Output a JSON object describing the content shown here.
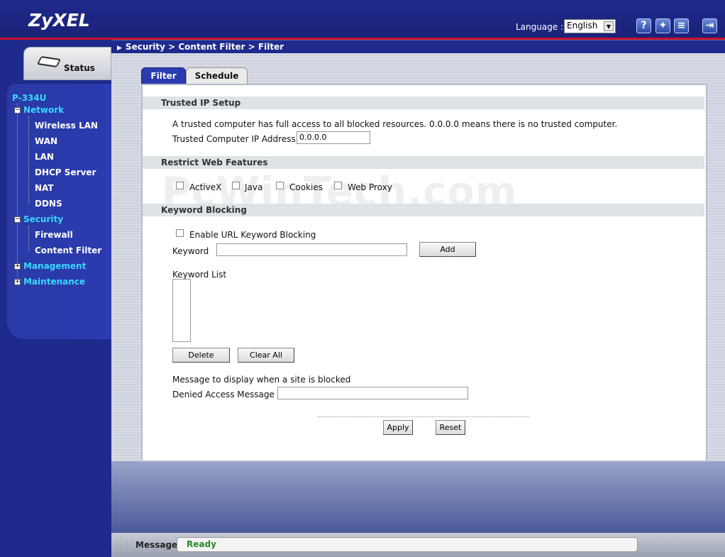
{
  "header": {
    "brand": "ZyXEL",
    "language_label": "Language :",
    "language_value": "English",
    "icons": [
      "help-icon",
      "wizard-icon",
      "about-icon",
      "logout-icon"
    ]
  },
  "breadcrumb": "Security > Content Filter > Filter",
  "sidebar": {
    "status_label": "Status",
    "device": "P-334U",
    "items": [
      {
        "label": "Network",
        "level": 0,
        "expanded": true
      },
      {
        "label": "Wireless LAN",
        "level": 1
      },
      {
        "label": "WAN",
        "level": 1
      },
      {
        "label": "LAN",
        "level": 1
      },
      {
        "label": "DHCP Server",
        "level": 1
      },
      {
        "label": "NAT",
        "level": 1
      },
      {
        "label": "DDNS",
        "level": 1
      },
      {
        "label": "Security",
        "level": 0,
        "expanded": true
      },
      {
        "label": "Firewall",
        "level": 1
      },
      {
        "label": "Content Filter",
        "level": 1
      },
      {
        "label": "Management",
        "level": 0,
        "expanded": false
      },
      {
        "label": "Maintenance",
        "level": 0,
        "expanded": false
      }
    ]
  },
  "tabs": [
    {
      "label": "Filter",
      "active": true
    },
    {
      "label": "Schedule",
      "active": false
    }
  ],
  "trusted_ip": {
    "heading": "Trusted IP Setup",
    "description": "A trusted computer has full access to all blocked resources. 0.0.0.0 means there is no trusted computer.",
    "address_label": "Trusted Computer IP Address:",
    "address_value": "0.0.0.0"
  },
  "restrict": {
    "heading": "Restrict Web Features",
    "options": [
      {
        "label": "ActiveX",
        "checked": false
      },
      {
        "label": "Java",
        "checked": false
      },
      {
        "label": "Cookies",
        "checked": false
      },
      {
        "label": "Web Proxy",
        "checked": false
      }
    ]
  },
  "keyword": {
    "heading": "Keyword Blocking",
    "enable_label": "Enable URL Keyword Blocking",
    "enable_checked": false,
    "keyword_label": "Keyword",
    "keyword_value": "",
    "add_label": "Add",
    "list_label": "Keyword List",
    "delete_label": "Delete",
    "clear_label": "Clear All",
    "message_intro": "Message to display when a site is blocked",
    "denied_label": "Denied Access Message",
    "denied_value": ""
  },
  "actions": {
    "apply_label": "Apply",
    "reset_label": "Reset"
  },
  "watermark": "PcWinTech.com",
  "footer": {
    "label": "Message",
    "status": "Ready"
  },
  "colors": {
    "header_blue": "#1e2a8c",
    "accent_red": "#c8102e",
    "nav_cyan": "#38d8ff",
    "status_green": "#2a8a2a"
  }
}
